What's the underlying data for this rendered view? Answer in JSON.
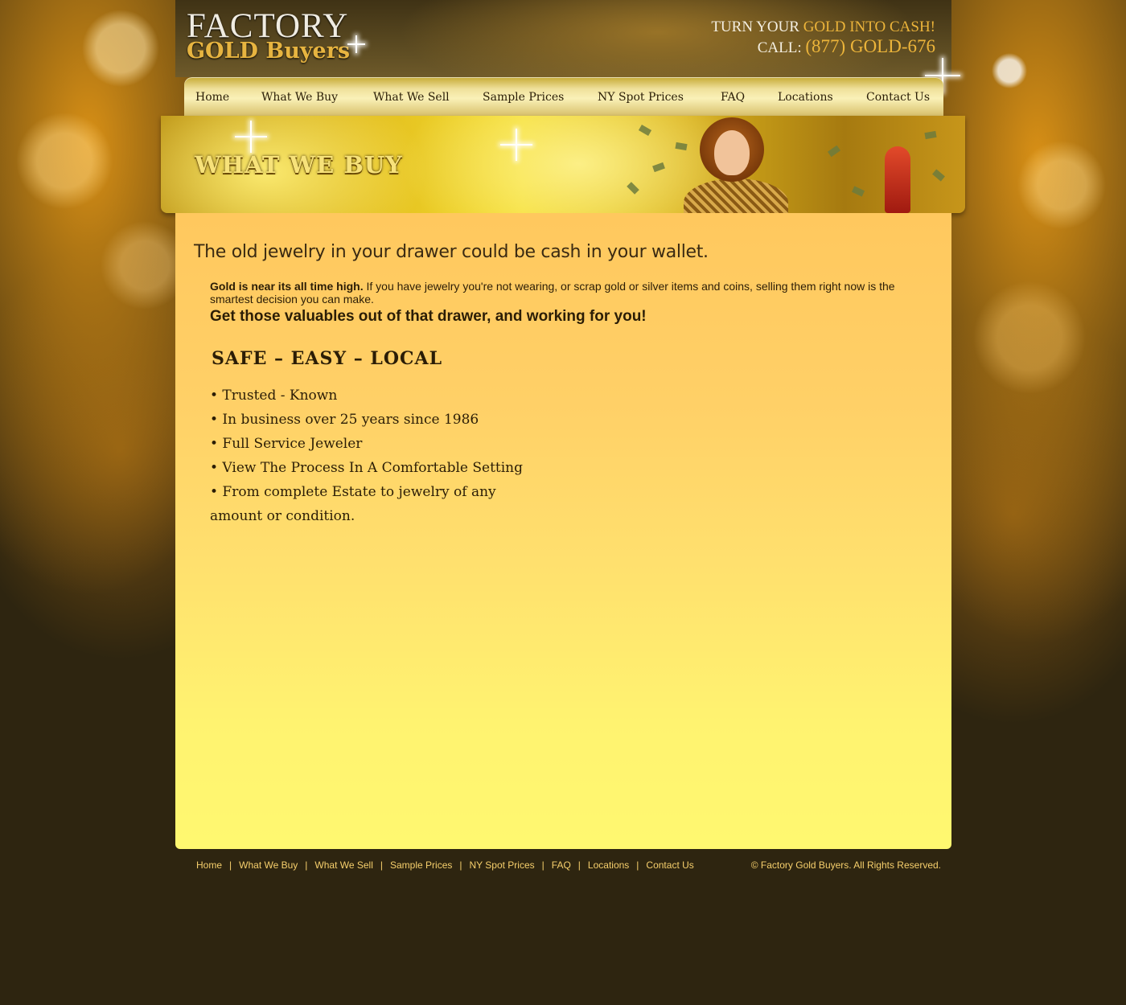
{
  "header": {
    "logo_line1": "FACTORY",
    "logo_line2": "GOLD Buyers",
    "tagline_prefix": "TURN YOUR ",
    "tagline_highlight": "GOLD INTO CASH!",
    "call_label": "CALL: ",
    "phone": "(877) GOLD-676"
  },
  "nav": {
    "items": [
      "Home",
      "What We Buy",
      "What We Sell",
      "Sample Prices",
      "NY Spot Prices",
      "FAQ",
      "Locations",
      "Contact Us"
    ]
  },
  "banner": {
    "title": "WHAT WE BUY"
  },
  "content": {
    "headline": "The old jewelry in your drawer could be cash in your wallet.",
    "intro_bold": "Gold is near its all time high.",
    "intro_text": " If you have jewelry you're not wearing, or scrap gold or silver items and coins, selling them right now is the smartest decision you can make.",
    "cta": "Get those valuables out of that drawer, and working for you!",
    "selling_points": "SAFE – EASY – LOCAL",
    "bullets": [
      "• Trusted - Known",
      "• In business over 25 years since 1986",
      "• Full Service Jeweler",
      "• View The Process In A Comfortable Setting",
      "• From complete Estate to jewelry of any"
    ],
    "bullet_continuation": "amount or condition."
  },
  "footer": {
    "links": [
      "Home",
      "What We Buy",
      "What We Sell",
      "Sample Prices",
      "NY Spot Prices",
      "FAQ",
      "Locations",
      "Contact Us"
    ],
    "separator": "|",
    "copyright": "© Factory Gold Buyers. All Rights Reserved."
  },
  "colors": {
    "page_bg": "#2e2510",
    "gold_accent": "#ecb43a",
    "content_top": "#ffc85e",
    "content_bottom": "#fff870",
    "footer_text": "#f6cf6c"
  }
}
